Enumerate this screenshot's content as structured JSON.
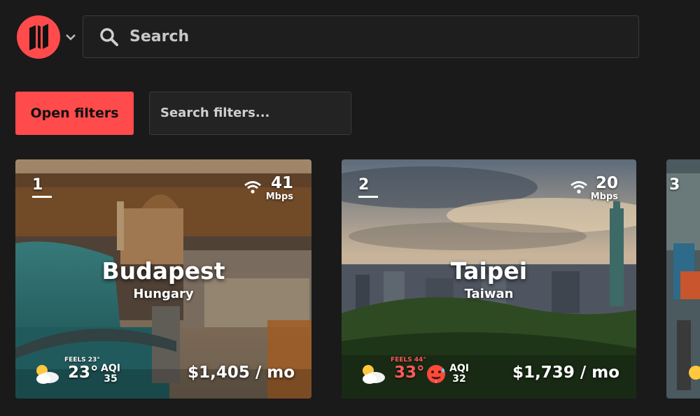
{
  "header": {
    "search_placeholder": "Search"
  },
  "filters": {
    "open_label": "Open filters",
    "search_placeholder": "Search filters..."
  },
  "colors": {
    "accent": "#ff4b4b",
    "background": "#1a1a1a",
    "hot": "#ff5a5a"
  },
  "cards": [
    {
      "rank": "1",
      "speed": "41",
      "speed_unit": "Mbps",
      "city": "Budapest",
      "country": "Hungary",
      "feels": "FEELS 23°",
      "temp": "23°",
      "aqi_label": "AQI",
      "aqi": "35",
      "price": "$1,405 / mo",
      "weather_icon": "partly-cloudy-icon"
    },
    {
      "rank": "2",
      "speed": "20",
      "speed_unit": "Mbps",
      "city": "Taipei",
      "country": "Taiwan",
      "feels": "FEELS 44°",
      "temp": "33°",
      "aqi_label": "AQI",
      "aqi": "32",
      "price": "$1,739 / mo",
      "weather_icon": "partly-cloudy-icon",
      "extra_icon": "hot-face-icon"
    },
    {
      "rank": "3"
    }
  ]
}
